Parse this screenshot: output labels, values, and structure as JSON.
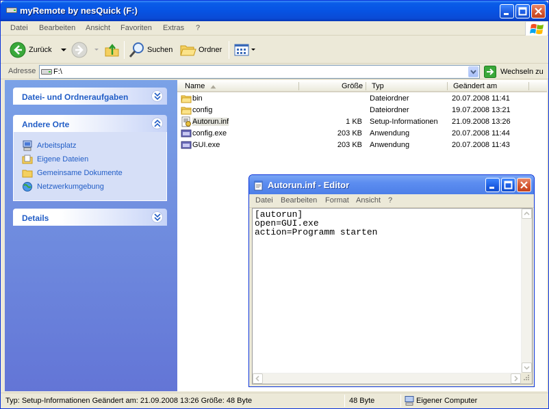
{
  "explorer": {
    "title": "myRemote by nesQuick (F:)",
    "menu": [
      "Datei",
      "Bearbeiten",
      "Ansicht",
      "Favoriten",
      "Extras",
      "?"
    ],
    "toolbar": {
      "back_label": "Zurück",
      "search_label": "Suchen",
      "folders_label": "Ordner"
    },
    "address": {
      "label": "Adresse",
      "value": "F:\\",
      "go_label": "Wechseln zu"
    },
    "tasks": {
      "file_tasks_title": "Datei- und Ordneraufgaben",
      "other_places_title": "Andere Orte",
      "other_places": [
        "Arbeitsplatz",
        "Eigene Dateien",
        "Gemeinsame Dokumente",
        "Netzwerkumgebung"
      ],
      "details_title": "Details"
    },
    "columns": {
      "name": "Name",
      "size": "Größe",
      "type": "Typ",
      "modified": "Geändert am"
    },
    "files": [
      {
        "name": "bin",
        "size": "",
        "type": "Dateiordner",
        "modified": "20.07.2008 11:41",
        "icon": "folder-icon"
      },
      {
        "name": "config",
        "size": "",
        "type": "Dateiordner",
        "modified": "19.07.2008 13:21",
        "icon": "folder-icon"
      },
      {
        "name": "Autorun.inf",
        "size": "1 KB",
        "type": "Setup-Informationen",
        "modified": "21.09.2008 13:26",
        "icon": "setup-info-icon"
      },
      {
        "name": "config.exe",
        "size": "203 KB",
        "type": "Anwendung",
        "modified": "20.07.2008 11:44",
        "icon": "exe-icon"
      },
      {
        "name": "GUI.exe",
        "size": "203 KB",
        "type": "Anwendung",
        "modified": "20.07.2008 11:43",
        "icon": "exe-icon"
      }
    ],
    "status": {
      "info": "Typ: Setup-Informationen Geändert am: 21.09.2008 13:26 Größe: 48 Byte",
      "size": "48 Byte",
      "location": "Eigener Computer"
    }
  },
  "notepad": {
    "title": "Autorun.inf - Editor",
    "menu": [
      "Datei",
      "Bearbeiten",
      "Format",
      "Ansicht",
      "?"
    ],
    "content": "[autorun]\nopen=GUI.exe\naction=Programm starten"
  },
  "colors": {
    "title_blue": "#0a5ce8",
    "task_link": "#215dc6",
    "panel_bg": "#d6dff7",
    "chrome": "#ece9d8"
  }
}
